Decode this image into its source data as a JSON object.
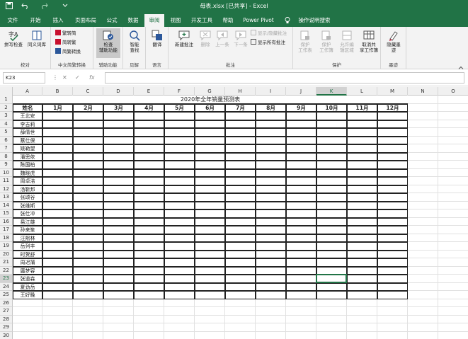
{
  "window": {
    "title": "母表.xlsx  [已共享]  -  Excel"
  },
  "quick_access": {
    "save_icon": "save-icon",
    "undo_icon": "undo-icon",
    "redo_icon": "redo-icon",
    "customize_icon": "chevron-down-icon"
  },
  "tabs": [
    "文件",
    "开始",
    "插入",
    "页面布局",
    "公式",
    "数据",
    "审阅",
    "视图",
    "开发工具",
    "帮助",
    "Power Pivot"
  ],
  "active_tab": "审阅",
  "tell_me": "操作说明搜索",
  "ribbon": {
    "groups": [
      {
        "label": "校对",
        "buttons": [
          "拼写检查",
          "同义词库"
        ]
      },
      {
        "label": "中文简繁转换",
        "buttons": [
          "繁转简",
          "简转繁",
          "简繁转换"
        ]
      },
      {
        "label": "辅助功能",
        "buttons": [
          "检查",
          "辅助功能"
        ]
      },
      {
        "label": "见解",
        "buttons": [
          "智能",
          "查找"
        ]
      },
      {
        "label": "语言",
        "buttons": [
          "翻译"
        ]
      },
      {
        "label": "批注",
        "buttons": [
          "新建批注",
          "删除",
          "上一条",
          "下一条",
          "显示/隐藏批注",
          "显示所有批注"
        ]
      },
      {
        "label": "保护",
        "buttons": [
          "保护",
          "工作表",
          "保护",
          "工作簿",
          "允许编",
          "辑区域",
          "取消共",
          "享工作簿"
        ]
      },
      {
        "label": "墨迹",
        "buttons": [
          "隐藏墨",
          "迹"
        ]
      }
    ]
  },
  "formula_bar": {
    "name_box": "K23",
    "formula": ""
  },
  "columns": [
    "A",
    "B",
    "C",
    "D",
    "E",
    "F",
    "G",
    "H",
    "I",
    "J",
    "K",
    "L",
    "M",
    "N",
    "O"
  ],
  "selected_column": "K",
  "rows": [
    "1",
    "2",
    "3",
    "4",
    "5",
    "6",
    "7",
    "8",
    "9",
    "10",
    "11",
    "12",
    "13",
    "14",
    "15",
    "16",
    "17",
    "18",
    "19",
    "20",
    "21",
    "22",
    "23",
    "24",
    "25",
    "26",
    "27",
    "28",
    "29",
    "30"
  ],
  "selected_row": "23",
  "sheet": {
    "title": "2020年全年销量预测表",
    "header_name": "姓名",
    "months": [
      "1月",
      "2月",
      "3月",
      "4月",
      "5月",
      "6月",
      "7月",
      "8月",
      "9月",
      "10月",
      "11月",
      "12月"
    ],
    "names": [
      "王北安",
      "李吉莉",
      "薛倩世",
      "蔡仕保",
      "姚勒望",
      "潘思依",
      "陈国柏",
      "魏晓虎",
      "周卓洁",
      "汤靳邦",
      "张颂谷",
      "张维斯",
      "张仕冲",
      "易江雄",
      "孙来笙",
      "汪熙林",
      "岳列丰",
      "时贺舒",
      "周迟蒲",
      "庸梦容",
      "张道森",
      "夏劲岳",
      "王好晚"
    ]
  },
  "active_cell": "K23"
}
